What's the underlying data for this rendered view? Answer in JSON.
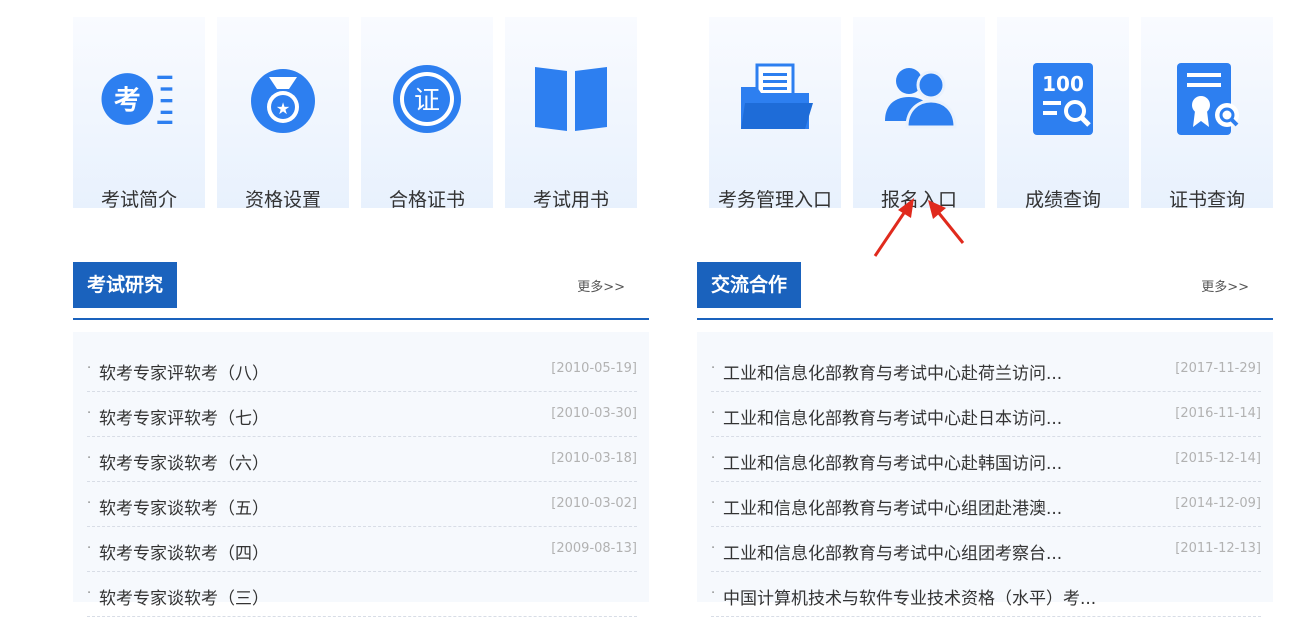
{
  "left_tiles": [
    {
      "label": "考试简介",
      "icon": "exam-intro-icon",
      "glyph": "考"
    },
    {
      "label": "资格设置",
      "icon": "medal-icon",
      "glyph": "★"
    },
    {
      "label": "合格证书",
      "icon": "certificate-seal-icon",
      "glyph": "证"
    },
    {
      "label": "考试用书",
      "icon": "book-icon"
    }
  ],
  "right_tiles": [
    {
      "label": "考务管理入口",
      "icon": "folder-icon"
    },
    {
      "label": "报名入口",
      "icon": "users-icon"
    },
    {
      "label": "成绩查询",
      "icon": "score-query-icon",
      "glyph": "100"
    },
    {
      "label": "证书查询",
      "icon": "certificate-query-icon"
    }
  ],
  "research": {
    "title": "考试研究",
    "more": "更多>>",
    "items": [
      {
        "title": "软考专家评软考（八）",
        "date": "[2010-05-19]"
      },
      {
        "title": "软考专家评软考（七）",
        "date": "[2010-03-30]"
      },
      {
        "title": "软考专家谈软考（六）",
        "date": "[2010-03-18]"
      },
      {
        "title": "软考专家谈软考（五）",
        "date": "[2010-03-02]"
      },
      {
        "title": "软考专家谈软考（四）",
        "date": "[2009-08-13]"
      },
      {
        "title": "软考专家谈软考（三）",
        "date": ""
      }
    ]
  },
  "cooperation": {
    "title": "交流合作",
    "more": "更多>>",
    "items": [
      {
        "title": "工业和信息化部教育与考试中心赴荷兰访问...",
        "date": "[2017-11-29]"
      },
      {
        "title": "工业和信息化部教育与考试中心赴日本访问...",
        "date": "[2016-11-14]"
      },
      {
        "title": "工业和信息化部教育与考试中心赴韩国访问...",
        "date": "[2015-12-14]"
      },
      {
        "title": "工业和信息化部教育与考试中心组团赴港澳...",
        "date": "[2014-12-09]"
      },
      {
        "title": "工业和信息化部教育与考试中心组团考察台...",
        "date": "[2011-12-13]"
      },
      {
        "title": "中国计算机技术与软件专业技术资格（水平）考...",
        "date": ""
      }
    ]
  },
  "bullet": "·",
  "colors": {
    "accent": "#1a62bd",
    "icon_blue": "#2d7ff0",
    "arrow": "#e02a1d"
  }
}
